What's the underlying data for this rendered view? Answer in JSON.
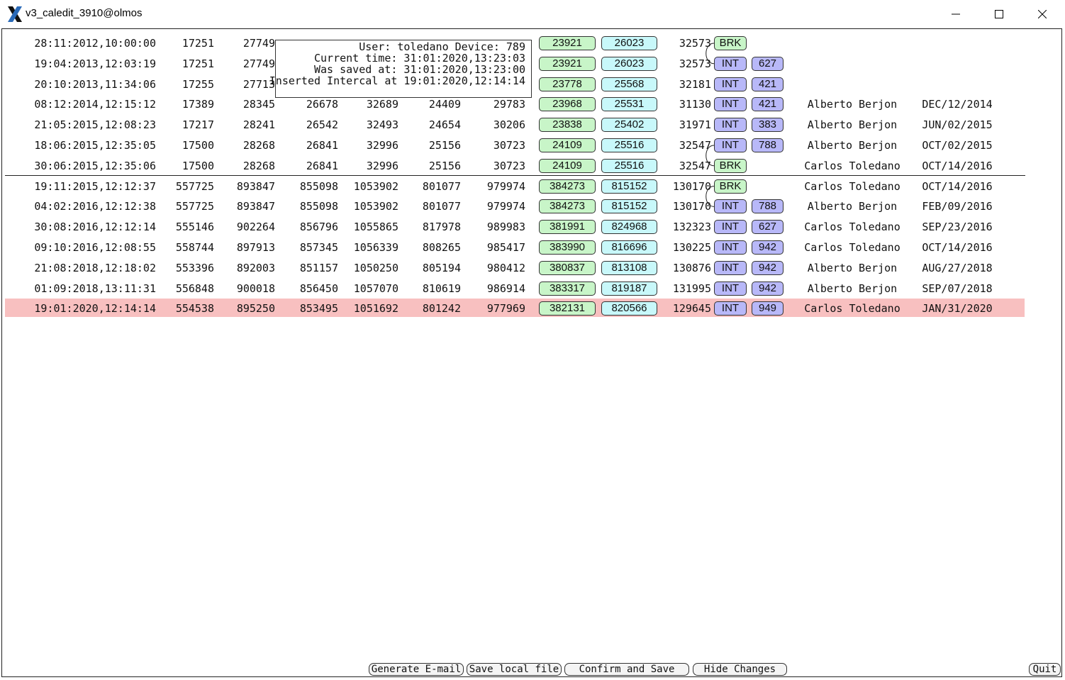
{
  "window": {
    "title": "v3_caledit_3910@olmos",
    "minimize_glyph": "—",
    "maximize_glyph": "☐",
    "close_glyph": "✕"
  },
  "tooltip": {
    "line1": "User: toledano Device: 789",
    "line2": "Current time: 31:01:2020,13:23:03",
    "line3": "Was saved at: 31:01:2020,13:23:00",
    "line4": "Inserted Intercal at 19:01:2020,12:14:14"
  },
  "rows": [
    {
      "date": "28:11:2012,10:00:00",
      "v1": "17251",
      "v2": "27749",
      "v3": "",
      "v4": "",
      "v5": "",
      "v6": "",
      "g": "23921",
      "c": "26023",
      "n": "32573",
      "tag": "BRK",
      "tag_color": "green",
      "num": "",
      "name": "",
      "stamp": ""
    },
    {
      "date": "19:04:2013,12:03:19",
      "v1": "17251",
      "v2": "27749",
      "v3": "",
      "v4": "",
      "v5": "",
      "v6": "",
      "g": "23921",
      "c": "26023",
      "n": "32573",
      "tag": "INT",
      "tag_color": "lav",
      "num": "627",
      "name": "",
      "stamp": ""
    },
    {
      "date": "20:10:2013,11:34:06",
      "v1": "17255",
      "v2": "27713",
      "v3": "",
      "v4": "",
      "v5": "",
      "v6": "",
      "g": "23778",
      "c": "25568",
      "n": "32181",
      "tag": "INT",
      "tag_color": "lav",
      "num": "421",
      "name": "",
      "stamp": ""
    },
    {
      "date": "08:12:2014,12:15:12",
      "v1": "17389",
      "v2": "28345",
      "v3": "26678",
      "v4": "32689",
      "v5": "24409",
      "v6": "29783",
      "g": "23968",
      "c": "25531",
      "n": "31130",
      "tag": "INT",
      "tag_color": "lav",
      "num": "421",
      "name": "Alberto Berjon",
      "stamp": "DEC/12/2014"
    },
    {
      "date": "21:05:2015,12:08:23",
      "v1": "17217",
      "v2": "28241",
      "v3": "26542",
      "v4": "32493",
      "v5": "24654",
      "v6": "30206",
      "g": "23838",
      "c": "25402",
      "n": "31971",
      "tag": "INT",
      "tag_color": "lav",
      "num": "383",
      "name": "Alberto Berjon",
      "stamp": "JUN/02/2015"
    },
    {
      "date": "18:06:2015,12:35:05",
      "v1": "17500",
      "v2": "28268",
      "v3": "26841",
      "v4": "32996",
      "v5": "25156",
      "v6": "30723",
      "g": "24109",
      "c": "25516",
      "n": "32547",
      "tag": "INT",
      "tag_color": "lav",
      "num": "788",
      "name": "Alberto Berjon",
      "stamp": "OCT/02/2015"
    },
    {
      "date": "30:06:2015,12:35:06",
      "v1": "17500",
      "v2": "28268",
      "v3": "26841",
      "v4": "32996",
      "v5": "25156",
      "v6": "30723",
      "g": "24109",
      "c": "25516",
      "n": "32547",
      "tag": "BRK",
      "tag_color": "green",
      "num": "",
      "name": "Carlos Toledano",
      "stamp": "OCT/14/2016"
    },
    {
      "date": "19:11:2015,12:12:37",
      "v1": "557725",
      "v2": "893847",
      "v3": "855098",
      "v4": "1053902",
      "v5": "801077",
      "v6": "979974",
      "g": "384273",
      "c": "815152",
      "n": "130170",
      "tag": "BRK",
      "tag_color": "green",
      "num": "",
      "name": "Carlos Toledano",
      "stamp": "OCT/14/2016"
    },
    {
      "date": "04:02:2016,12:12:38",
      "v1": "557725",
      "v2": "893847",
      "v3": "855098",
      "v4": "1053902",
      "v5": "801077",
      "v6": "979974",
      "g": "384273",
      "c": "815152",
      "n": "130170",
      "tag": "INT",
      "tag_color": "lav",
      "num": "788",
      "name": "Alberto Berjon",
      "stamp": "FEB/09/2016"
    },
    {
      "date": "30:08:2016,12:12:14",
      "v1": "555146",
      "v2": "902264",
      "v3": "856796",
      "v4": "1055865",
      "v5": "817978",
      "v6": "989983",
      "g": "381991",
      "c": "824968",
      "n": "132323",
      "tag": "INT",
      "tag_color": "lav",
      "num": "627",
      "name": "Carlos Toledano",
      "stamp": "SEP/23/2016"
    },
    {
      "date": "09:10:2016,12:08:55",
      "v1": "558744",
      "v2": "897913",
      "v3": "857345",
      "v4": "1056339",
      "v5": "808265",
      "v6": "985417",
      "g": "383990",
      "c": "816696",
      "n": "130225",
      "tag": "INT",
      "tag_color": "lav",
      "num": "942",
      "name": "Carlos Toledano",
      "stamp": "OCT/14/2016"
    },
    {
      "date": "21:08:2018,12:18:02",
      "v1": "553396",
      "v2": "892003",
      "v3": "851157",
      "v4": "1050250",
      "v5": "805194",
      "v6": "980412",
      "g": "380837",
      "c": "813108",
      "n": "130876",
      "tag": "INT",
      "tag_color": "lav",
      "num": "942",
      "name": "Alberto Berjon",
      "stamp": "AUG/27/2018"
    },
    {
      "date": "01:09:2018,13:11:31",
      "v1": "556848",
      "v2": "900018",
      "v3": "856450",
      "v4": "1057070",
      "v5": "810619",
      "v6": "986914",
      "g": "383317",
      "c": "819187",
      "n": "131995",
      "tag": "INT",
      "tag_color": "lav",
      "num": "942",
      "name": "Alberto Berjon",
      "stamp": "SEP/07/2018"
    },
    {
      "date": "19:01:2020,12:14:14",
      "v1": "554538",
      "v2": "895250",
      "v3": "853495",
      "v4": "1051692",
      "v5": "801242",
      "v6": "977969",
      "g": "382131",
      "c": "820566",
      "n": "129645",
      "tag": "INT",
      "tag_color": "lav",
      "num": "949",
      "name": "Carlos Toledano",
      "stamp": "JAN/31/2020"
    }
  ],
  "buttons": {
    "email": "Generate E-mail",
    "save_local": "Save local file",
    "confirm": "Confirm and Save",
    "hide": "Hide Changes",
    "quit": "Quit"
  },
  "colors": {
    "green": "#c8f5c8",
    "cyan": "#c8f8fa",
    "lavender": "#b8b8f8",
    "highlight": "#f8c0c0"
  }
}
